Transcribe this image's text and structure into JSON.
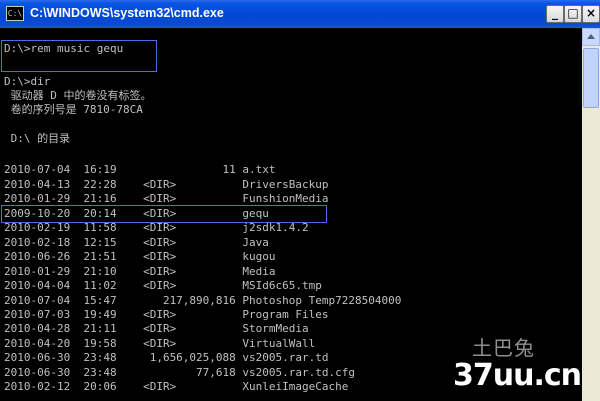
{
  "window": {
    "title": "C:\\WINDOWS\\system32\\cmd.exe",
    "icon_text": "C:\\",
    "buttons": {
      "minimize": "_",
      "maximize": "□",
      "close": "×"
    }
  },
  "console": {
    "lines": [
      "D:\\>rem music gequ",
      "",
      "D:\\>dir",
      " 驱动器 D 中的卷没有标签。",
      " 卷的序列号是 7810-78CA",
      "",
      " D:\\ 的目录",
      "",
      "2010-07-04  16:19                11 a.txt",
      "2010-04-13  22:28    <DIR>          DriversBackup",
      "2010-01-29  21:16    <DIR>          FunshionMedia",
      "2009-10-20  20:14    <DIR>          gequ",
      "2010-02-19  11:58    <DIR>          j2sdk1.4.2",
      "2010-02-18  12:15    <DIR>          Java",
      "2010-06-26  21:51    <DIR>          kugou",
      "2010-01-29  21:10    <DIR>          Media",
      "2010-04-04  11:02    <DIR>          MSId6c65.tmp",
      "2010-07-04  15:47       217,890,816 Photoshop Temp7228504000",
      "2010-07-03  19:49    <DIR>          Program Files",
      "2010-04-28  21:11    <DIR>          StormMedia",
      "2010-04-20  19:58    <DIR>          VirtualWall",
      "2010-06-30  23:48     1,656,025,088 vs2005.rar.td",
      "2010-06-30  23:48            77,618 vs2005.rar.td.cfg",
      "2010-02-12  20:06    <DIR>          XunleiImageCache"
    ]
  },
  "watermark": {
    "top": "土巴兔",
    "bottom": "37uu.cn"
  },
  "colors": {
    "titlebar": "#0a54e3",
    "console_bg": "#000000",
    "console_text": "#c0c0c0",
    "highlight": "#4a6ee8"
  }
}
